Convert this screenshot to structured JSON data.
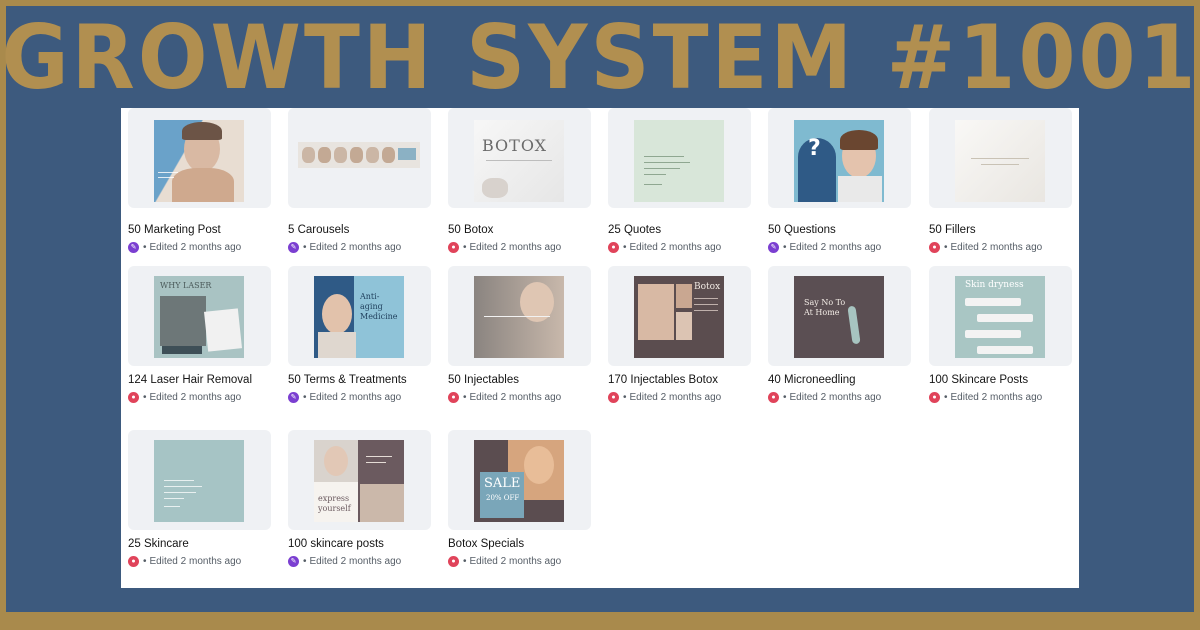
{
  "banner": {
    "title": "GROWTH SYSTEM #1001"
  },
  "designs": [
    {
      "title": "50 Marketing Post",
      "meta": "Edited 2 months ago",
      "owner": "purple"
    },
    {
      "title": "5 Carousels",
      "meta": "Edited 2 months ago",
      "owner": "purple"
    },
    {
      "title": "50 Botox",
      "meta": "Edited 2 months ago",
      "owner": "red",
      "thumb_text": "BOTOX"
    },
    {
      "title": "25 Quotes",
      "meta": "Edited 2 months ago",
      "owner": "red"
    },
    {
      "title": "50 Questions",
      "meta": "Edited 2 months ago",
      "owner": "purple",
      "thumb_text": "?"
    },
    {
      "title": "50 Fillers",
      "meta": "Edited 2 months ago",
      "owner": "red"
    },
    {
      "title": "124 Laser Hair Removal",
      "meta": "Edited 2 months ago",
      "owner": "red",
      "thumb_text": "WHY LASER"
    },
    {
      "title": "50  Terms & Treatments",
      "meta": "Edited 2 months ago",
      "owner": "purple",
      "thumb_text": "Anti-aging Medicine"
    },
    {
      "title": "50 Injectables",
      "meta": "Edited 2 months ago",
      "owner": "red"
    },
    {
      "title": "170 Injectables Botox",
      "meta": "Edited 2 months ago",
      "owner": "red",
      "thumb_text": "Botox"
    },
    {
      "title": "40 Microneedling",
      "meta": "Edited 2 months ago",
      "owner": "red",
      "thumb_text": "Say No To At Home"
    },
    {
      "title": "100 Skincare Posts",
      "meta": "Edited 2 months ago",
      "owner": "red",
      "thumb_text": "Skin dryness"
    },
    {
      "title": "25 Skincare",
      "meta": "Edited 2 months ago",
      "owner": "red"
    },
    {
      "title": "100 skincare posts",
      "meta": "Edited 2 months ago",
      "owner": "purple",
      "thumb_text": "express yourself"
    },
    {
      "title": "Botox Specials",
      "meta": "Edited 2 months ago",
      "owner": "red",
      "thumb_text": "SALE",
      "thumb_text_2": "20% OFF"
    }
  ],
  "colors": {
    "background": "#3d5a7e",
    "border": "#a98a4c",
    "title": "#b18f50"
  }
}
